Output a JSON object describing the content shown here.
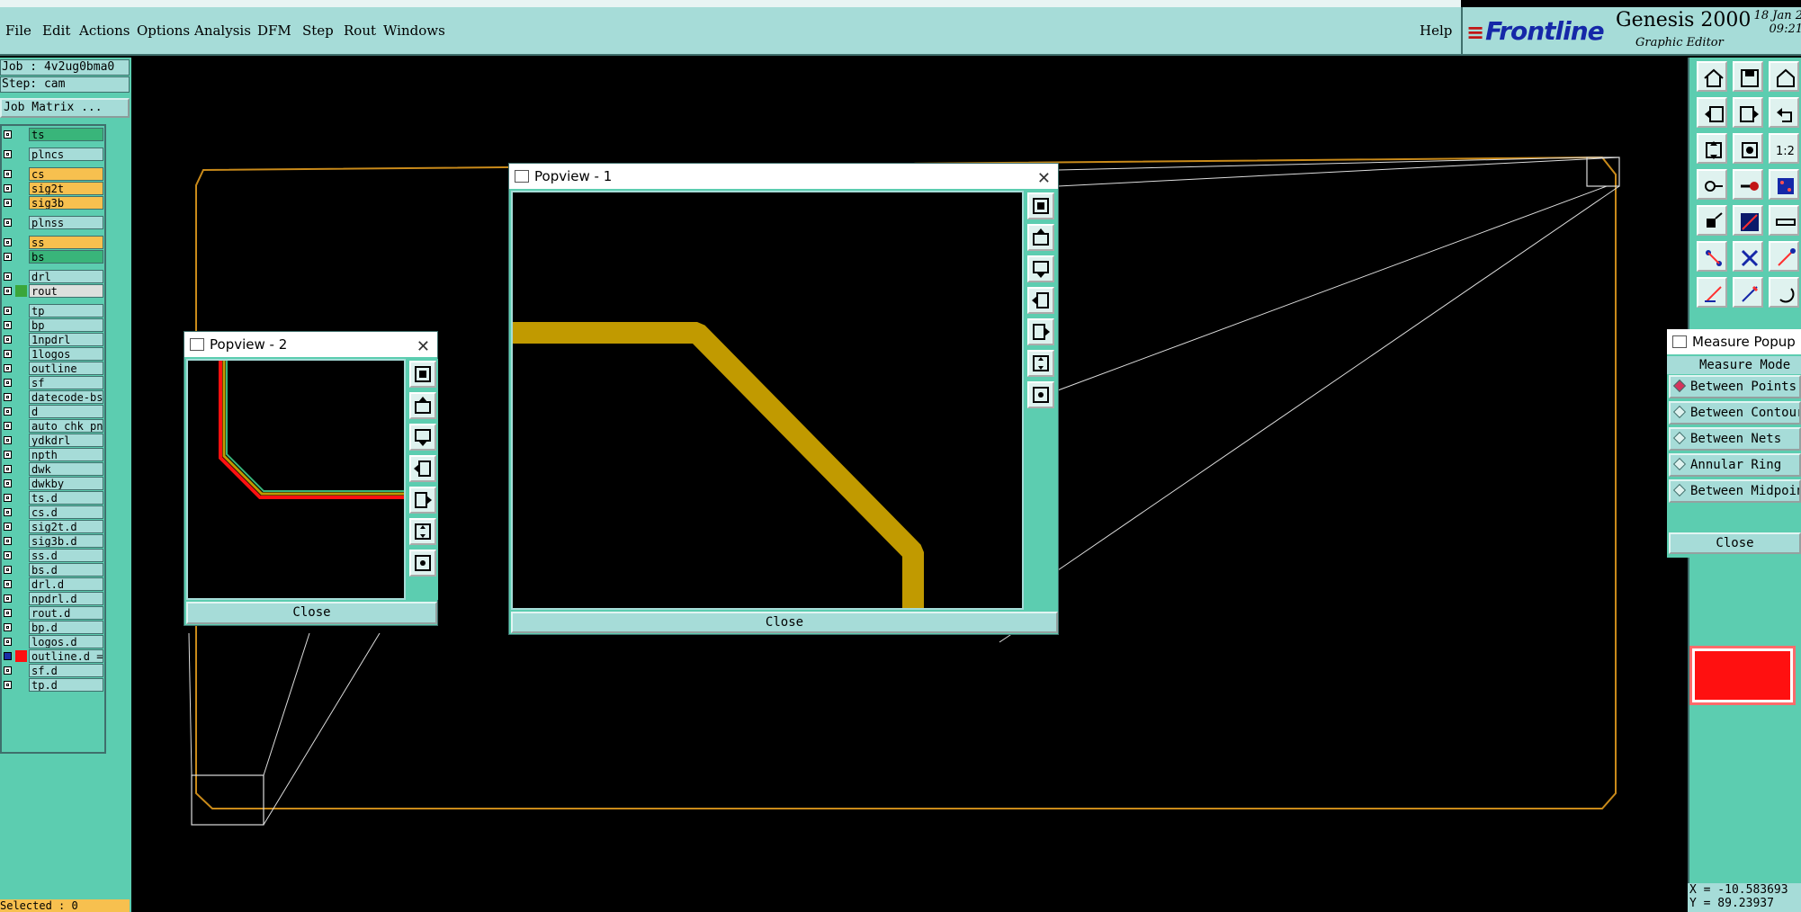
{
  "menu": {
    "items": [
      "File",
      "Edit",
      "Actions",
      "Options",
      "Analysis",
      "DFM",
      "Step",
      "Rout",
      "Windows"
    ],
    "help": "Help"
  },
  "brand": {
    "logo": "Frontline",
    "product": "Genesis 2000",
    "subtitle": "Graphic Editor",
    "date": "18 Jan 2",
    "time": "09:21"
  },
  "job": {
    "job_label": "Job : 4v2ug0bma0",
    "step_label": "Step: cam",
    "matrix_button": "Job Matrix ..."
  },
  "layers": [
    {
      "name": "ts",
      "color": "#39b57a",
      "swatch": "",
      "group": 0
    },
    {
      "name": "plncs",
      "color": "#a6dcd8",
      "swatch": "",
      "group": 1
    },
    {
      "name": "cs",
      "color": "#f7c04f",
      "swatch": "",
      "group": 2
    },
    {
      "name": "sig2t",
      "color": "#f7c04f",
      "swatch": "",
      "group": 2
    },
    {
      "name": "sig3b",
      "color": "#f7c04f",
      "swatch": "",
      "group": 2
    },
    {
      "name": "plnss",
      "color": "#a6dcd8",
      "swatch": "",
      "group": 3
    },
    {
      "name": "ss",
      "color": "#f7c04f",
      "swatch": "",
      "group": 4
    },
    {
      "name": "bs",
      "color": "#39b57a",
      "swatch": "",
      "group": 4
    },
    {
      "name": "drl",
      "color": "#a6dcd8",
      "swatch": "",
      "group": 5
    },
    {
      "name": "rout",
      "color": "#dde0dd",
      "swatch": "#3aa63a",
      "group": 5
    },
    {
      "name": "tp",
      "color": "#a6dcd8",
      "swatch": "",
      "group": 6
    },
    {
      "name": "bp",
      "color": "#a6dcd8",
      "swatch": "",
      "group": 6
    },
    {
      "name": "1npdrl",
      "color": "#a6dcd8",
      "swatch": "",
      "group": 6
    },
    {
      "name": "1logos",
      "color": "#a6dcd8",
      "swatch": "",
      "group": 6
    },
    {
      "name": "outline",
      "color": "#a6dcd8",
      "swatch": "",
      "group": 6
    },
    {
      "name": "sf",
      "color": "#a6dcd8",
      "swatch": "",
      "group": 6
    },
    {
      "name": "datecode-bs",
      "color": "#a6dcd8",
      "swatch": "",
      "group": 6
    },
    {
      "name": "d",
      "color": "#a6dcd8",
      "swatch": "",
      "group": 6
    },
    {
      "name": "auto_chk_pn",
      "color": "#a6dcd8",
      "swatch": "",
      "group": 6
    },
    {
      "name": "ydkdrl",
      "color": "#a6dcd8",
      "swatch": "",
      "group": 6
    },
    {
      "name": "npth",
      "color": "#a6dcd8",
      "swatch": "",
      "group": 6
    },
    {
      "name": "dwk",
      "color": "#a6dcd8",
      "swatch": "",
      "group": 6
    },
    {
      "name": "dwkby",
      "color": "#a6dcd8",
      "swatch": "",
      "group": 6
    },
    {
      "name": "ts.d",
      "color": "#a6dcd8",
      "swatch": "",
      "group": 6
    },
    {
      "name": "cs.d",
      "color": "#a6dcd8",
      "swatch": "",
      "group": 6
    },
    {
      "name": "sig2t.d",
      "color": "#a6dcd8",
      "swatch": "",
      "group": 6
    },
    {
      "name": "sig3b.d",
      "color": "#a6dcd8",
      "swatch": "",
      "group": 6
    },
    {
      "name": "ss.d",
      "color": "#a6dcd8",
      "swatch": "",
      "group": 6
    },
    {
      "name": "bs.d",
      "color": "#a6dcd8",
      "swatch": "",
      "group": 6
    },
    {
      "name": "drl.d",
      "color": "#a6dcd8",
      "swatch": "",
      "group": 6
    },
    {
      "name": "npdrl.d",
      "color": "#a6dcd8",
      "swatch": "",
      "group": 6
    },
    {
      "name": "rout.d",
      "color": "#a6dcd8",
      "swatch": "",
      "group": 6
    },
    {
      "name": "bp.d",
      "color": "#a6dcd8",
      "swatch": "",
      "group": 6
    },
    {
      "name": "logos.d",
      "color": "#a6dcd8",
      "swatch": "",
      "group": 6
    },
    {
      "name": "outline.d =",
      "color": "#a6dcd8",
      "swatch": "#ff1010",
      "group": 6,
      "active": true
    },
    {
      "name": "sf.d",
      "color": "#a6dcd8",
      "swatch": "",
      "group": 6
    },
    {
      "name": "tp.d",
      "color": "#a6dcd8",
      "swatch": "",
      "group": 6
    }
  ],
  "status": {
    "selected": "Selected : 0",
    "x": "X = -10.583693",
    "y": "Y = 89.23937"
  },
  "popview1": {
    "title": "Popview - 1",
    "close": "Close"
  },
  "popview2": {
    "title": "Popview - 2",
    "close": "Close"
  },
  "measure": {
    "title": "Measure Popup",
    "mode_label": "Measure Mode",
    "options": [
      "Between Points",
      "Between Contours",
      "Between Nets",
      "Annular Ring",
      "Between Midpoints"
    ],
    "selected_index": 0,
    "close": "Close"
  },
  "colors": {
    "trace": "#c19a00",
    "outline": "#c98a1a",
    "panel": "#5ccdb0",
    "menu": "#a6dcd8"
  }
}
